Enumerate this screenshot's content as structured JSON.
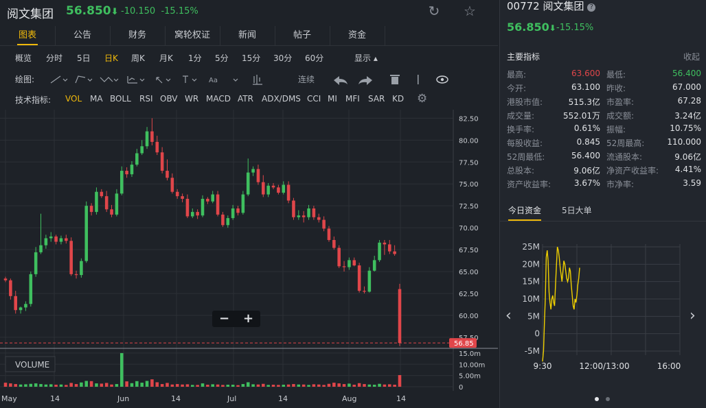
{
  "header": {
    "name": "阅文集团",
    "price": "56.850",
    "arrow": "⬇",
    "change": "-10.150",
    "pct": "-15.15%"
  },
  "tabs": [
    "图表",
    "公告",
    "财务",
    "窝轮权证",
    "新闻",
    "帖子",
    "资金"
  ],
  "active_tab": 0,
  "periods": [
    "概览",
    "分时",
    "5日",
    "日K",
    "周K",
    "月K",
    "1分",
    "5分",
    "15分",
    "30分",
    "60分"
  ],
  "active_period": 3,
  "display_label": "显示",
  "draw": {
    "label": "绘图:",
    "continuous": "连续"
  },
  "indicators": {
    "label": "技术指标:",
    "items": [
      "VOL",
      "MA",
      "BOLL",
      "RSI",
      "OBV",
      "WR",
      "MACD",
      "ATR",
      "ADX/DMS",
      "CCI",
      "MI",
      "MFI",
      "SAR",
      "KD"
    ],
    "active": 0
  },
  "main_chart": {
    "y_ticks": [
      "82.50",
      "80.00",
      "77.50",
      "75.00",
      "72.50",
      "70.00",
      "67.50",
      "65.00",
      "62.50",
      "60.00",
      "57.50"
    ],
    "last_price_tag": "56.85",
    "x_labels": [
      "May",
      "14",
      "Jun",
      "14",
      "Jul",
      "14",
      "Aug",
      "14"
    ],
    "volume_label": "VOLUME",
    "vol_ticks": [
      "15.0m",
      "10.00m",
      "5.00m",
      "0"
    ],
    "up_color": "#3fbf5f",
    "down_color": "#e0464a"
  },
  "chart_data": {
    "type": "candlestick",
    "x": [
      "Apr-30",
      "May-01",
      "May-02",
      "May-03",
      "May-06",
      "May-07",
      "May-08",
      "May-09",
      "May-10",
      "May-13",
      "May-14",
      "May-15",
      "May-16",
      "May-17",
      "May-20",
      "May-21",
      "May-22",
      "May-23",
      "May-24",
      "May-27",
      "May-28",
      "May-29",
      "May-30",
      "May-31",
      "Jun-03",
      "Jun-04",
      "Jun-05",
      "Jun-06",
      "Jun-07",
      "Jun-10",
      "Jun-11",
      "Jun-12",
      "Jun-13",
      "Jun-14",
      "Jun-17",
      "Jun-18",
      "Jun-19",
      "Jun-20",
      "Jun-21",
      "Jun-24",
      "Jun-25",
      "Jun-26",
      "Jun-27",
      "Jun-28",
      "Jul-01",
      "Jul-02",
      "Jul-03",
      "Jul-04",
      "Jul-05",
      "Jul-08",
      "Jul-09",
      "Jul-10",
      "Jul-11",
      "Jul-12",
      "Jul-15",
      "Jul-16",
      "Jul-17",
      "Jul-18",
      "Jul-19",
      "Jul-22",
      "Jul-23",
      "Jul-24",
      "Jul-25",
      "Jul-26",
      "Jul-29",
      "Jul-30",
      "Jul-31",
      "Aug-01",
      "Aug-02",
      "Aug-05",
      "Aug-06",
      "Aug-07",
      "Aug-08",
      "Aug-09",
      "Aug-12",
      "Aug-13",
      "Aug-14",
      "Aug-15",
      "Aug-16"
    ],
    "open": [
      64.2,
      64.0,
      62.2,
      60.6,
      60.9,
      61.3,
      64.7,
      67.2,
      68.0,
      68.8,
      69.0,
      68.4,
      68.8,
      68.5,
      64.7,
      64.6,
      66.2,
      72.5,
      71.8,
      74.1,
      73.6,
      72.1,
      71.5,
      73.9,
      76.5,
      76.1,
      77.2,
      78.5,
      79.3,
      81.0,
      79.8,
      78.6,
      76.5,
      75.7,
      74.1,
      73.6,
      73.3,
      71.3,
      71.8,
      71.4,
      73.3,
      73.0,
      73.8,
      71.5,
      70.3,
      71.1,
      72.2,
      71.7,
      73.8,
      76.3,
      76.7,
      75.2,
      73.8,
      74.8,
      74.6,
      74.0,
      74.9,
      73.1,
      71.2,
      71.4,
      71.2,
      72.2,
      71.2,
      70.9,
      69.9,
      68.6,
      67.7,
      65.6,
      65.5,
      66.3,
      65.7,
      62.8,
      62.7,
      65.1,
      66.3,
      68.3,
      68.1,
      67.3,
      63.0
    ],
    "close": [
      64.0,
      62.2,
      60.6,
      60.9,
      61.3,
      64.7,
      67.2,
      68.0,
      68.8,
      69.0,
      68.4,
      68.8,
      68.5,
      64.7,
      64.6,
      66.2,
      72.5,
      71.8,
      74.1,
      73.6,
      72.1,
      71.5,
      73.9,
      76.5,
      76.1,
      77.2,
      78.5,
      79.3,
      81.0,
      79.8,
      78.6,
      76.5,
      75.7,
      74.1,
      73.6,
      73.3,
      71.3,
      71.8,
      71.4,
      73.3,
      73.0,
      73.8,
      71.5,
      70.3,
      71.1,
      72.2,
      71.7,
      73.8,
      76.3,
      76.7,
      75.2,
      73.8,
      74.8,
      74.6,
      74.0,
      74.9,
      73.1,
      71.2,
      71.4,
      71.2,
      72.2,
      71.2,
      70.9,
      69.9,
      68.6,
      67.7,
      65.6,
      65.5,
      66.3,
      65.7,
      62.8,
      62.7,
      65.1,
      66.3,
      68.3,
      68.1,
      67.3,
      67.0,
      56.85
    ],
    "high": [
      64.4,
      64.2,
      62.8,
      61.0,
      61.6,
      65.0,
      67.8,
      71.6,
      69.2,
      69.5,
      69.2,
      69.1,
      69.2,
      68.9,
      65.1,
      66.5,
      73.0,
      72.8,
      74.6,
      74.4,
      74.2,
      72.6,
      74.4,
      77.0,
      76.9,
      77.6,
      79.0,
      80.0,
      81.5,
      82.5,
      80.5,
      79.2,
      77.8,
      76.2,
      74.4,
      73.9,
      73.8,
      72.2,
      72.1,
      73.7,
      73.5,
      74.2,
      74.2,
      71.8,
      71.4,
      72.6,
      72.5,
      74.2,
      77.9,
      77.0,
      77.2,
      76.0,
      75.1,
      75.1,
      74.9,
      75.3,
      75.3,
      73.4,
      72.0,
      71.9,
      72.6,
      72.5,
      71.6,
      71.3,
      70.2,
      69.0,
      68.0,
      66.2,
      66.6,
      66.6,
      66.0,
      63.3,
      65.5,
      66.8,
      68.6,
      68.6,
      68.6,
      68.0,
      63.6
    ],
    "low": [
      63.8,
      61.8,
      60.2,
      60.2,
      60.5,
      61.0,
      64.4,
      67.0,
      67.6,
      68.4,
      68.1,
      68.1,
      68.2,
      64.5,
      64.2,
      64.3,
      66.0,
      71.4,
      71.5,
      73.4,
      71.8,
      71.2,
      71.3,
      73.7,
      75.7,
      75.8,
      77.0,
      78.3,
      79.0,
      79.4,
      78.3,
      76.2,
      75.4,
      73.9,
      73.3,
      72.9,
      71.1,
      71.1,
      71.0,
      71.2,
      72.7,
      72.8,
      71.3,
      70.1,
      70.0,
      70.9,
      71.4,
      71.5,
      73.6,
      75.9,
      74.9,
      73.5,
      73.5,
      74.4,
      73.8,
      73.8,
      72.8,
      70.9,
      70.9,
      70.6,
      70.9,
      70.9,
      70.6,
      69.6,
      68.4,
      67.5,
      65.4,
      65.0,
      65.2,
      65.6,
      62.6,
      62.5,
      62.6,
      65.0,
      66.1,
      66.9,
      67.0,
      66.8,
      56.5
    ],
    "volume_m": [
      1.8,
      1.5,
      1.2,
      1.0,
      1.1,
      1.3,
      1.5,
      1.2,
      1.0,
      1.1,
      0.9,
      1.0,
      0.8,
      1.7,
      1.2,
      1.9,
      2.6,
      2.5,
      1.5,
      1.4,
      1.7,
      1.0,
      1.2,
      15.0,
      2.4,
      1.6,
      2.5,
      1.8,
      2.6,
      3.3,
      2.0,
      1.2,
      1.7,
      1.0,
      1.2,
      1.0,
      1.1,
      0.8,
      0.8,
      1.5,
      0.9,
      1.1,
      1.0,
      0.8,
      0.9,
      0.9,
      0.7,
      1.2,
      2.0,
      1.1,
      1.0,
      1.3,
      0.8,
      0.9,
      0.8,
      0.9,
      1.0,
      1.2,
      1.0,
      1.0,
      0.8,
      1.1,
      1.0,
      0.8,
      1.3,
      1.8,
      1.5,
      1.2,
      1.4,
      0.9,
      1.6,
      1.2,
      1.0,
      0.9,
      1.3,
      1.0,
      1.1,
      0.9,
      5.2
    ],
    "ylim": [
      56.0,
      83.0
    ],
    "last_price": 56.85
  },
  "right": {
    "code_name": "00772 阅文集团",
    "price": "56.850",
    "arrow": "⬇",
    "pct": "-15.15%",
    "section_title": "主要指标",
    "collapse": "收起",
    "metrics": [
      {
        "k1": "最高:",
        "v1": "63.600",
        "c1": "#e0464a",
        "k2": "最低:",
        "v2": "56.400",
        "c2": "#3fbf5f"
      },
      {
        "k1": "今开:",
        "v1": "63.100",
        "c1": "",
        "k2": "昨收:",
        "v2": "67.000",
        "c2": ""
      },
      {
        "k1": "港股市值:",
        "v1": "515.3亿",
        "c1": "",
        "k2": "市盈率:",
        "v2": "67.28",
        "c2": ""
      },
      {
        "k1": "成交量:",
        "v1": "552.01万",
        "c1": "",
        "k2": "成交额:",
        "v2": "3.24亿",
        "c2": ""
      },
      {
        "k1": "换手率:",
        "v1": "0.61%",
        "c1": "",
        "k2": "振幅:",
        "v2": "10.75%",
        "c2": ""
      },
      {
        "k1": "每股收益:",
        "v1": "0.845",
        "c1": "",
        "k2": "52周最高:",
        "v2": "110.000",
        "c2": ""
      },
      {
        "k1": "52周最低:",
        "v1": "56.400",
        "c1": "",
        "k2": "流通股本:",
        "v2": "9.06亿",
        "c2": ""
      },
      {
        "k1": "总股本:",
        "v1": "9.06亿",
        "c1": "",
        "k2": "净资产收益率:",
        "v2": "4.41%",
        "c2": ""
      },
      {
        "k1": "资产收益率:",
        "v1": "3.67%",
        "c1": "",
        "k2": "市净率:",
        "v2": "3.59",
        "c2": ""
      }
    ],
    "tabs": [
      "今日资金",
      "5日大单"
    ],
    "active_tab": 0,
    "mini_y_ticks": [
      "25M",
      "20M",
      "15M",
      "10M",
      "5M",
      "0",
      "-5M"
    ],
    "mini_x_ticks": [
      "9:30",
      "12:00/13:00",
      "16:00"
    ],
    "flow_color": "#f0d000"
  },
  "flow_chart_data": {
    "type": "line",
    "x": [
      0,
      1,
      2,
      3,
      4,
      5,
      6,
      7,
      8,
      9,
      10,
      11,
      12,
      13,
      14,
      15,
      16,
      17,
      18,
      19,
      20,
      21,
      22,
      23,
      24,
      25,
      26,
      27,
      28,
      29,
      30,
      31,
      32,
      33,
      34,
      35,
      36,
      37,
      38,
      39,
      40
    ],
    "values_m": [
      -8,
      -5,
      3,
      10,
      22,
      24,
      21,
      12,
      9,
      7,
      10,
      11,
      9,
      8,
      14,
      20,
      25,
      24,
      22,
      19,
      17,
      15,
      18,
      21,
      20,
      18,
      16,
      15,
      16,
      19,
      18,
      14,
      11,
      8,
      7,
      10,
      9,
      11,
      14,
      16,
      19
    ],
    "ylim": [
      -8,
      27
    ]
  },
  "icons": [
    "refresh-icon",
    "star-icon",
    "question-icon",
    "settings-icon",
    "eye-icon",
    "trash-icon",
    "undo-icon",
    "redo-icon",
    "chevron-left-icon",
    "chevron-right-icon"
  ]
}
